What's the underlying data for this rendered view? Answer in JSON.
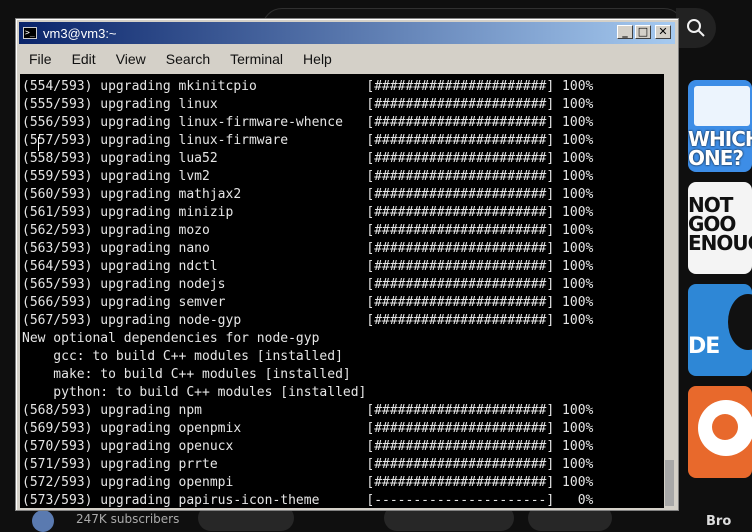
{
  "background": {
    "subscribers": "247K subscribers",
    "thumbnails": [
      {
        "text": "WHICH ONE?"
      },
      {
        "text": "NOT GOO ENOUG"
      },
      {
        "text": "DE"
      },
      {
        "text": ""
      }
    ],
    "corner_text": "Bro"
  },
  "window": {
    "title": "vm3@vm3:~",
    "buttons": {
      "minimize": "_",
      "maximize": "□",
      "close": "✕"
    }
  },
  "menu": [
    "File",
    "Edit",
    "View",
    "Search",
    "Terminal",
    "Help"
  ],
  "terminal": {
    "lines": [
      "(554/593) upgrading mkinitcpio              [######################] 100%",
      "(555/593) upgrading linux                   [######################] 100%",
      "(556/593) upgrading linux-firmware-whence   [######################] 100%",
      "(557/593) upgrading linux-firmware          [######################] 100%",
      "(558/593) upgrading lua52                   [######################] 100%",
      "(559/593) upgrading lvm2                    [######################] 100%",
      "(560/593) upgrading mathjax2                [######################] 100%",
      "(561/593) upgrading minizip                 [######################] 100%",
      "(562/593) upgrading mozo                    [######################] 100%",
      "(563/593) upgrading nano                    [######################] 100%",
      "(564/593) upgrading ndctl                   [######################] 100%",
      "(565/593) upgrading nodejs                  [######################] 100%",
      "(566/593) upgrading semver                  [######################] 100%",
      "(567/593) upgrading node-gyp                [######################] 100%",
      "New optional dependencies for node-gyp",
      "    gcc: to build C++ modules [installed]",
      "    make: to build C++ modules [installed]",
      "    python: to build C++ modules [installed]",
      "(568/593) upgrading npm                     [######################] 100%",
      "(569/593) upgrading openpmix                [######################] 100%",
      "(570/593) upgrading openucx                 [######################] 100%",
      "(571/593) upgrading prrte                   [######################] 100%",
      "(572/593) upgrading openmpi                 [######################] 100%",
      "(573/593) upgrading papirus-icon-theme      [----------------------]   0%"
    ]
  }
}
